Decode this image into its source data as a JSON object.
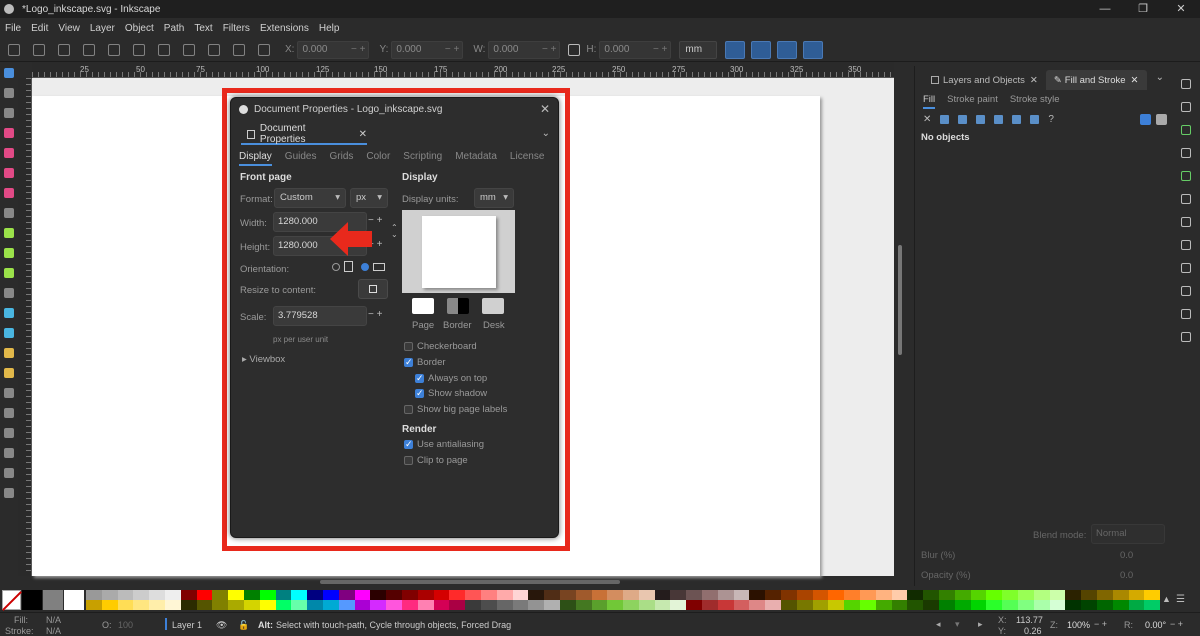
{
  "window": {
    "title": "*Logo_inkscape.svg - Inkscape",
    "controls": [
      "—",
      "❐",
      "✕"
    ]
  },
  "menu": [
    "File",
    "Edit",
    "View",
    "Layer",
    "Object",
    "Path",
    "Text",
    "Filters",
    "Extensions",
    "Help"
  ],
  "toolbar": {
    "x_label": "X:",
    "x_value": "0.000",
    "y_label": "Y:",
    "y_value": "0.000",
    "w_label": "W:",
    "w_value": "0.000",
    "h_label": "H:",
    "h_value": "0.000",
    "unit": "mm"
  },
  "ruler": {
    "top_ticks": [
      "25",
      "50",
      "75",
      "100",
      "125",
      "150",
      "175",
      "200",
      "225",
      "250",
      "275",
      "300",
      "325",
      "350"
    ]
  },
  "dialog": {
    "title": "Document Properties - Logo_inkscape.svg",
    "tab_label": "Document Properties",
    "subtabs": [
      "Display",
      "Guides",
      "Grids",
      "Color",
      "Scripting",
      "Metadata",
      "License"
    ],
    "front_page": {
      "heading": "Front page",
      "format_label": "Format:",
      "format_value": "Custom",
      "format_unit": "px",
      "width_label": "Width:",
      "width_value": "1280.000",
      "height_label": "Height:",
      "height_value": "1280.000",
      "orientation_label": "Orientation:",
      "resize_label": "Resize to content:",
      "scale_label": "Scale:",
      "scale_value": "3.779528",
      "scale_note": "px per user unit",
      "viewbox_label": "Viewbox"
    },
    "display": {
      "heading": "Display",
      "units_label": "Display units:",
      "units_value": "mm",
      "swatches": [
        {
          "label": "Page",
          "color": "#ffffff"
        },
        {
          "label": "Border",
          "color": "#000000"
        },
        {
          "label": "Desk",
          "color": "#d0d0d0"
        }
      ],
      "checkboxes": [
        {
          "label": "Checkerboard",
          "checked": false
        },
        {
          "label": "Border",
          "checked": true
        },
        {
          "label": "Always on top",
          "checked": true
        },
        {
          "label": "Show shadow",
          "checked": true
        },
        {
          "label": "Show big page labels",
          "checked": false
        }
      ],
      "render_heading": "Render",
      "render_checkboxes": [
        {
          "label": "Use antialiasing",
          "checked": true
        },
        {
          "label": "Clip to page",
          "checked": false
        }
      ]
    }
  },
  "right_panel": {
    "tabs": [
      {
        "label": "Layers and Objects"
      },
      {
        "label": "Fill and Stroke"
      }
    ],
    "subtabs": [
      "Fill",
      "Stroke paint",
      "Stroke style"
    ],
    "status": "No objects",
    "blend_mode_label": "Blend mode:",
    "blend_mode_value": "Normal",
    "blur_label": "Blur (%)",
    "blur_value": "0.0",
    "opacity_label": "Opacity (%)",
    "opacity_value": "0.0"
  },
  "statusbar": {
    "fill_label": "Fill:",
    "fill_value": "N/A",
    "stroke_label": "Stroke:",
    "stroke_value": "N/A",
    "opacity_label": "O:",
    "opacity_value": "100",
    "layer": "Layer 1",
    "message_bold": "Alt:",
    "message": "Select with touch-path, Cycle through objects, Forced Drag",
    "x_label": "X:",
    "x_value": "113.77",
    "y_label": "Y:",
    "y_value": "0.26",
    "zoom_label": "Z:",
    "zoom_value": "100%",
    "rotate_label": "R:",
    "rotate_value": "0.00°"
  },
  "colors": {
    "highlight_frame": "#e8291c",
    "accent": "#4a8fdd"
  }
}
